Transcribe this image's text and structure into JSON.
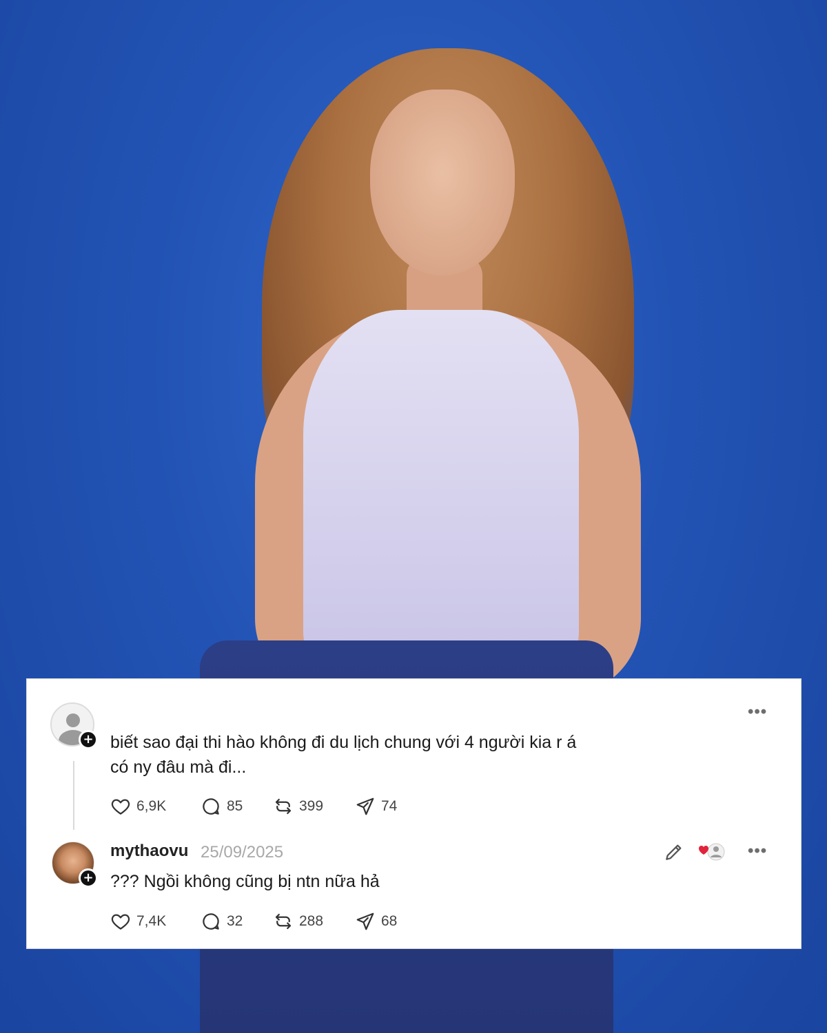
{
  "comments": [
    {
      "text_line1": "biết sao đại thi hào không đi du lịch chung với 4 người kia r á",
      "text_line2": "có ny đâu mà đi...",
      "stats": {
        "likes": "6,9K",
        "replies": "85",
        "reposts": "399",
        "shares": "74"
      }
    },
    {
      "username": "mythaovu",
      "date": "25/09/2025",
      "text": "??? Ngồi không cũng bị ntn nữa hả",
      "stats": {
        "likes": "7,4K",
        "replies": "32",
        "reposts": "288",
        "shares": "68"
      }
    }
  ],
  "icons": {
    "avatar": "default-user-avatar",
    "follow": "plus-icon",
    "more": "more-horizontal-icon",
    "like": "heart-icon",
    "reply": "comment-bubble-icon",
    "repost": "repost-icon",
    "share": "send-icon",
    "edit": "pencil-icon",
    "liked_by_author": "heart-user-icon"
  },
  "colors": {
    "background": "#1f4fb0",
    "card": "#ffffff",
    "text": "#1a1a1a",
    "muted": "#a8a8a8",
    "heart_red": "#e0243b"
  }
}
